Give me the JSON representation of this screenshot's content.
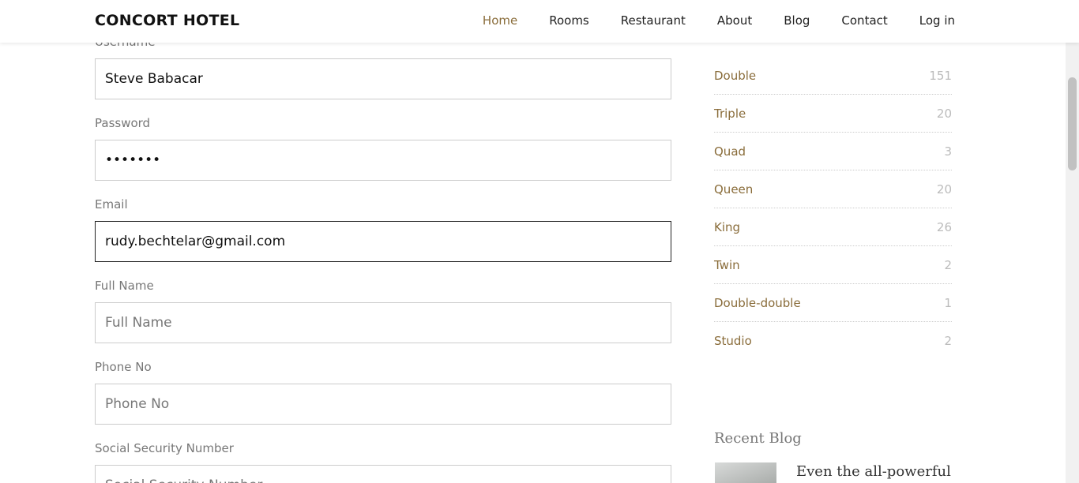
{
  "header": {
    "brand": "CONCORT HOTEL",
    "nav": [
      "Home",
      "Rooms",
      "Restaurant",
      "About",
      "Blog",
      "Contact",
      "Log in"
    ],
    "active_nav": "Home"
  },
  "form": {
    "fields": [
      {
        "label": "Username",
        "value": "Steve Babacar",
        "placeholder": ""
      },
      {
        "label": "Password",
        "value": "•••••••",
        "placeholder": ""
      },
      {
        "label": "Email",
        "value": "rudy.bechtelar@gmail.com",
        "placeholder": ""
      },
      {
        "label": "Full Name",
        "value": "",
        "placeholder": "Full Name"
      },
      {
        "label": "Phone No",
        "value": "",
        "placeholder": "Phone No"
      },
      {
        "label": "Social Security Number",
        "value": "",
        "placeholder": "Social Security Number"
      }
    ]
  },
  "sidebar": {
    "categories": [
      {
        "name": "Double",
        "count": "151"
      },
      {
        "name": "Triple",
        "count": "20"
      },
      {
        "name": "Quad",
        "count": "3"
      },
      {
        "name": "Queen",
        "count": "20"
      },
      {
        "name": "King",
        "count": "26"
      },
      {
        "name": "Twin",
        "count": "2"
      },
      {
        "name": "Double-double",
        "count": "1"
      },
      {
        "name": "Studio",
        "count": "2"
      }
    ],
    "recent_blog_title": "Recent Blog",
    "recent_blog_item": "Even the all-powerful"
  },
  "colors": {
    "accent": "#8a6d3b",
    "border": "#cccccc",
    "label": "#777777"
  }
}
